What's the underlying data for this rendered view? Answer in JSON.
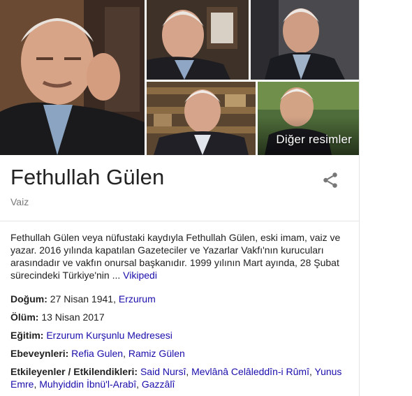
{
  "images": {
    "more_label": "Diğer resimler",
    "items": [
      {
        "icon": "portrait-main"
      },
      {
        "icon": "portrait-2"
      },
      {
        "icon": "portrait-3"
      },
      {
        "icon": "portrait-4"
      },
      {
        "icon": "portrait-5"
      }
    ]
  },
  "header": {
    "title": "Fethullah Gülen",
    "subtitle": "Vaiz",
    "share_icon": "share-icon"
  },
  "description": {
    "text": "Fethullah Gülen veya nüfustaki kaydıyla Fethullah Gülen, eski imam, vaiz ve yazar. 2016 yılında kapatılan Gazeteciler ve Yazarlar Vakfı'nın kurucuları arasındadır ve vakfın onursal başkanıdır. 1999 yılının Mart ayında, 28 Şubat sürecindeki Türkiye'nin ...",
    "source_link": "Vikipedi"
  },
  "facts": {
    "birth": {
      "label": "Doğum:",
      "value": "27 Nisan 1941,",
      "link": "Erzurum"
    },
    "death": {
      "label": "Ölüm:",
      "value": "13 Nisan 2017"
    },
    "education": {
      "label": "Eğitim:",
      "link": "Erzurum Kurşunlu Medresesi"
    },
    "parents": {
      "label": "Ebeveynleri:",
      "link1": "Refia Gulen",
      "sep": ",",
      "link2": "Ramiz Gülen"
    },
    "influences": {
      "label": "Etkileyenler / Etkilendikleri:",
      "links": [
        "Said Nursî",
        "Mevlânâ Celâleddîn-i Rûmî",
        "Yunus Emre",
        "Muhyiddin İbnü'l-Arabî",
        "Gazzâlî"
      ],
      "sep": ","
    }
  },
  "colors": {
    "link": "#1a0dab",
    "muted": "#777777",
    "text": "#222222"
  }
}
